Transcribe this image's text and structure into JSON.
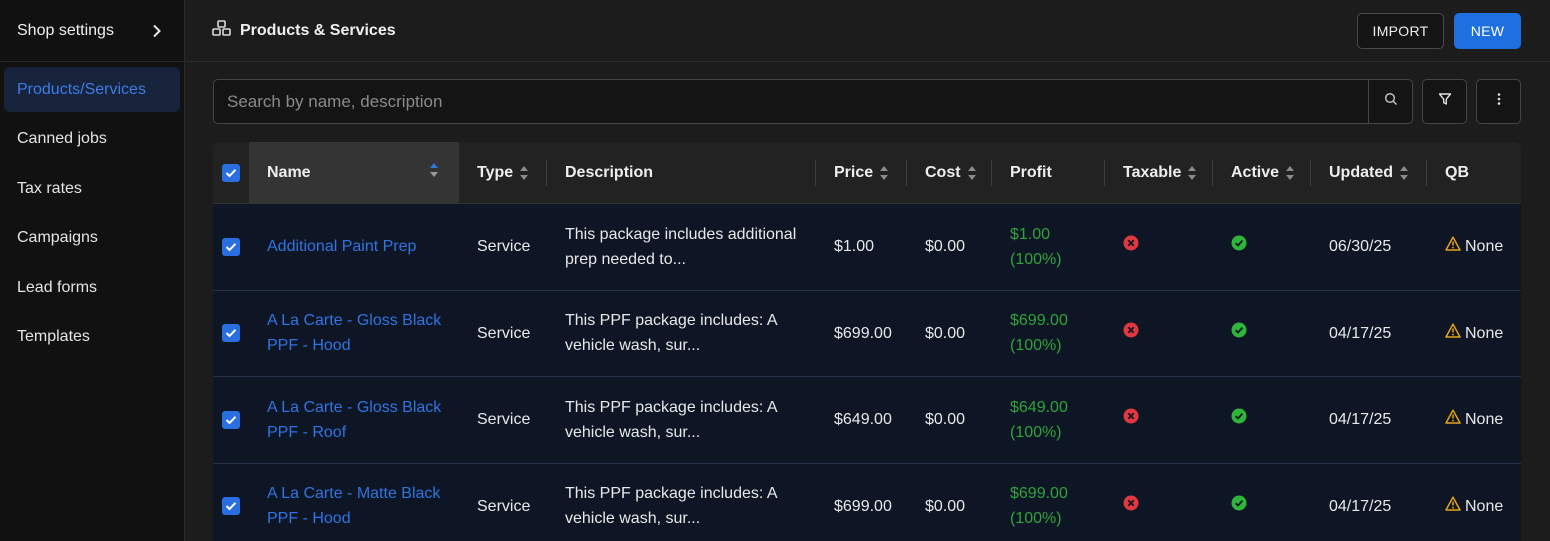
{
  "sidebar": {
    "header_title": "Shop settings",
    "items": [
      {
        "label": "Products/Services",
        "active": true
      },
      {
        "label": "Canned jobs"
      },
      {
        "label": "Tax rates"
      },
      {
        "label": "Campaigns"
      },
      {
        "label": "Lead forms"
      },
      {
        "label": "Templates"
      }
    ]
  },
  "header": {
    "title": "Products & Services",
    "import_label": "IMPORT",
    "new_label": "NEW"
  },
  "search": {
    "placeholder": "Search by name, description"
  },
  "table": {
    "columns": {
      "name": "Name",
      "type": "Type",
      "description": "Description",
      "price": "Price",
      "cost": "Cost",
      "profit": "Profit",
      "taxable": "Taxable",
      "active": "Active",
      "updated": "Updated",
      "qb": "QB"
    },
    "rows": [
      {
        "name_line1": "Additional Paint Prep",
        "name_line2": "",
        "type": "Service",
        "desc_line1": "This package includes additional",
        "desc_line2": "prep needed to...",
        "price": "$1.00",
        "cost": "$0.00",
        "profit_line1": "$1.00",
        "profit_line2": "(100%)",
        "updated": "06/30/25",
        "qb": "None"
      },
      {
        "name_line1": "A La Carte - Gloss Black",
        "name_line2": "PPF - Hood",
        "type": "Service",
        "desc_line1": "This PPF package includes: A",
        "desc_line2": "vehicle wash, sur...",
        "price": "$699.00",
        "cost": "$0.00",
        "profit_line1": "$699.00",
        "profit_line2": "(100%)",
        "updated": "04/17/25",
        "qb": "None"
      },
      {
        "name_line1": "A La Carte - Gloss Black",
        "name_line2": "PPF - Roof",
        "type": "Service",
        "desc_line1": "This PPF package includes: A",
        "desc_line2": "vehicle wash, sur...",
        "price": "$649.00",
        "cost": "$0.00",
        "profit_line1": "$649.00",
        "profit_line2": "(100%)",
        "updated": "04/17/25",
        "qb": "None"
      },
      {
        "name_line1": "A La Carte - Matte Black",
        "name_line2": "PPF - Hood",
        "type": "Service",
        "desc_line1": "This PPF package includes: A",
        "desc_line2": "vehicle wash, sur...",
        "price": "$699.00",
        "cost": "$0.00",
        "profit_line1": "$699.00",
        "profit_line2": "(100%)",
        "updated": "04/17/25",
        "qb": "None"
      }
    ]
  },
  "colors": {
    "accent": "#1e6fe0",
    "link": "#2f74e0",
    "profit": "#2fa33a",
    "not_taxable": "#e0383e",
    "active": "#2fb53a",
    "warning": "#e8a317"
  },
  "icons": [
    "chevron-right-icon",
    "products-icon",
    "search-icon",
    "filter-icon",
    "more-vertical-icon",
    "check-icon",
    "x-circle-icon",
    "check-circle-icon",
    "warning-icon",
    "sort-icon"
  ]
}
